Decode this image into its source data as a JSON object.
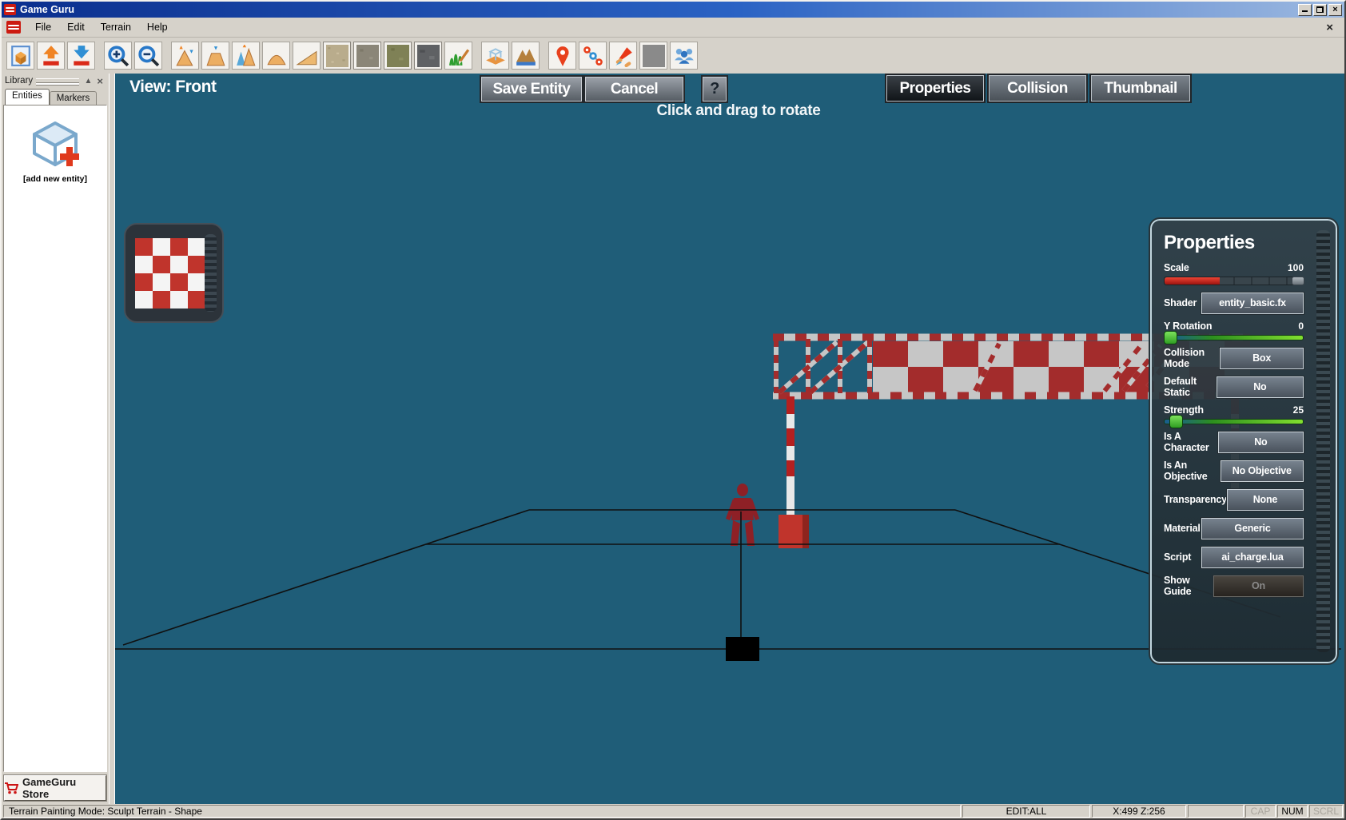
{
  "window": {
    "title": "Game Guru",
    "minimize": "minimize",
    "maximize": "restore",
    "close": "×"
  },
  "menu": {
    "items": [
      "File",
      "Edit",
      "Terrain",
      "Help"
    ],
    "close_label": "×"
  },
  "toolbar": {
    "icons": [
      {
        "name": "new-entity"
      },
      {
        "name": "export-model"
      },
      {
        "name": "import-model"
      },
      {
        "name": "zoom-in",
        "gap": true
      },
      {
        "name": "zoom-out"
      },
      {
        "name": "raise-terrain",
        "gap": true
      },
      {
        "name": "lower-terrain"
      },
      {
        "name": "blend-terrain"
      },
      {
        "name": "smooth-terrain"
      },
      {
        "name": "ramp-terrain"
      },
      {
        "name": "texture-sand",
        "texture": "#b9ac8c"
      },
      {
        "name": "texture-stone",
        "texture": "#8b8678"
      },
      {
        "name": "texture-moss",
        "texture": "#7f8156"
      },
      {
        "name": "texture-rock",
        "texture": "#5f6164"
      },
      {
        "name": "paint-grass"
      },
      {
        "name": "entity-mode",
        "gap": true
      },
      {
        "name": "terrain-mode"
      },
      {
        "name": "marker-mode",
        "gap": true
      },
      {
        "name": "waypoint-mode"
      },
      {
        "name": "test-game"
      },
      {
        "name": "blank-slot"
      },
      {
        "name": "multiplayer"
      }
    ]
  },
  "library": {
    "title": "Library",
    "tabs": [
      "Entities",
      "Markers"
    ],
    "active_tab": "Entities",
    "add_entity_label": "[add new entity]",
    "store_button": "GameGuru Store"
  },
  "viewport": {
    "view_label": "View: Front",
    "save_button": "Save Entity",
    "cancel_button": "Cancel",
    "help_button": "?",
    "tabs": [
      "Properties",
      "Collision",
      "Thumbnail"
    ],
    "active_tab": "Properties",
    "hint": "Click and drag to rotate"
  },
  "properties_panel": {
    "title": "Properties",
    "rows": [
      {
        "label": "Scale",
        "type": "slider",
        "style": "red",
        "value": "100",
        "fill": 40
      },
      {
        "label": "Shader",
        "type": "button",
        "value": "entity_basic.fx"
      },
      {
        "label": "Y Rotation",
        "type": "slider",
        "style": "green",
        "value": "0",
        "fill": 4
      },
      {
        "label": "Collision Mode",
        "type": "button",
        "value": "Box"
      },
      {
        "label": "Default Static",
        "type": "button",
        "value": "No"
      },
      {
        "label": "Strength",
        "type": "slider",
        "style": "green",
        "value": "25",
        "fill": 8
      },
      {
        "label": "Is A Character",
        "type": "button",
        "value": "No"
      },
      {
        "label": "Is An Objective",
        "type": "button",
        "value": "No Objective"
      },
      {
        "label": "Transparency",
        "type": "button",
        "value": "None"
      },
      {
        "label": "Material",
        "type": "button",
        "value": "Generic"
      },
      {
        "label": "Script",
        "type": "button",
        "value": "ai_charge.lua"
      },
      {
        "label": "Show Guide",
        "type": "button",
        "value": "On",
        "disabled": true
      }
    ]
  },
  "status_bar": {
    "mode": "Terrain Painting Mode: Sculpt Terrain - Shape",
    "edit": "EDIT:ALL",
    "coords": "X:499 Z:256",
    "cap": "CAP",
    "num": "NUM",
    "scrl": "SCRL"
  },
  "colors": {
    "viewport_bg": "#1f5d78",
    "barrier_red": "#a32c2c",
    "barrier_light": "#c6c6c6",
    "character_red": "#8e2026",
    "pedestal_red": "#c0342c",
    "slider_red": "#d42a20",
    "slider_green": "#4ec431"
  }
}
